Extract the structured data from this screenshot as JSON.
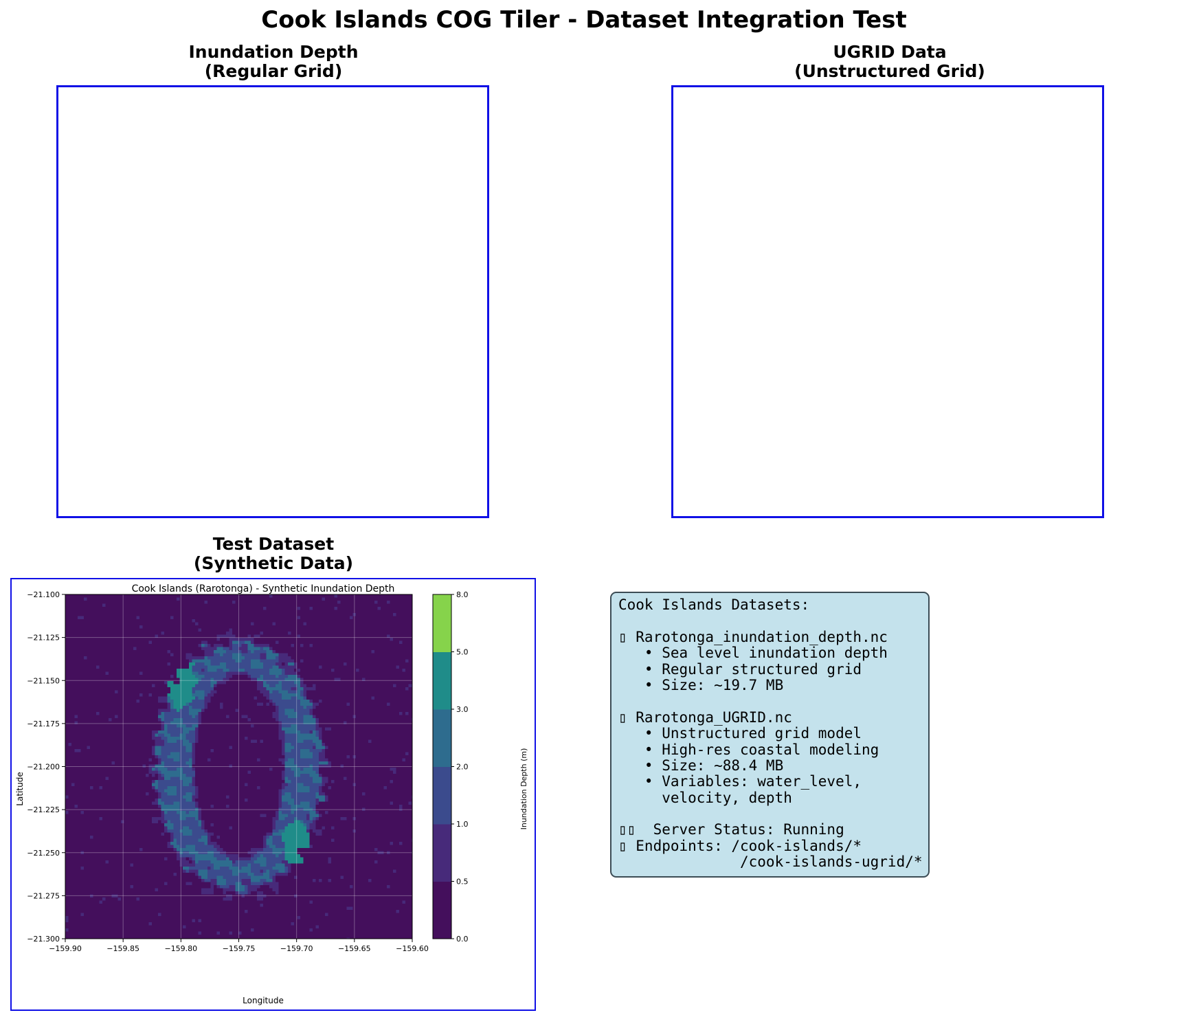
{
  "figure": {
    "title": "Cook Islands COG Tiler - Dataset Integration Test"
  },
  "panels": {
    "inundation": {
      "title_line1": "Inundation Depth",
      "title_line2": "(Regular Grid)"
    },
    "ugrid": {
      "title_line1": "UGRID Data",
      "title_line2": "(Unstructured Grid)"
    },
    "test": {
      "title_line1": "Test Dataset",
      "title_line2": "(Synthetic Data)"
    }
  },
  "colors": {
    "frame_border": "#1010e6",
    "info_box_bg": "#c4e2ec",
    "info_box_border": "#3c4c55"
  },
  "info_box": {
    "lines": [
      "Cook Islands Datasets:",
      "",
      "▯ Rarotonga_inundation_depth.nc",
      "   • Sea level inundation depth",
      "   • Regular structured grid",
      "   • Size: ~19.7 MB",
      "",
      "▯ Rarotonga_UGRID.nc",
      "   • Unstructured grid model",
      "   • High-res coastal modeling",
      "   • Size: ~88.4 MB",
      "   • Variables: water_level,",
      "     velocity, depth",
      "",
      "▯▯  Server Status: Running",
      "▯ Endpoints: /cook-islands/*",
      "              /cook-islands-ugrid/*"
    ]
  },
  "chart_data": {
    "type": "heatmap",
    "title": "Cook Islands (Rarotonga) - Synthetic Inundation Depth",
    "xlabel": "Longitude",
    "ylabel": "Latitude",
    "xlim": [
      -159.9,
      -159.6
    ],
    "ylim": [
      -21.3,
      -21.1
    ],
    "x_ticks": [
      -159.9,
      -159.85,
      -159.8,
      -159.75,
      -159.7,
      -159.65,
      -159.6
    ],
    "x_tick_labels": [
      "−159.90",
      "−159.85",
      "−159.80",
      "−159.75",
      "−159.70",
      "−159.65",
      "−159.60"
    ],
    "y_ticks": [
      -21.1,
      -21.125,
      -21.15,
      -21.175,
      -21.2,
      -21.225,
      -21.25,
      -21.275,
      -21.3
    ],
    "y_tick_labels": [
      "−21.100",
      "−21.125",
      "−21.150",
      "−21.175",
      "−21.200",
      "−21.225",
      "−21.250",
      "−21.275",
      "−21.300"
    ],
    "grid": true,
    "colorbar": {
      "label": "Inundation Depth (m)",
      "levels": [
        0.0,
        0.5,
        1.0,
        2.0,
        3.0,
        5.0,
        8.0
      ],
      "level_labels": [
        "0.0",
        "0.5",
        "1.0",
        "2.0",
        "3.0",
        "5.0",
        "8.0"
      ],
      "colors": [
        "#440f5c",
        "#472a7a",
        "#3b4b8d",
        "#2e6c8e",
        "#1f8c89",
        "#86d34b"
      ]
    },
    "features": {
      "ring_center": [
        -159.75,
        -21.2
      ],
      "ring_outer_radius_deg": [
        0.075,
        0.075
      ],
      "ring_inner_radius_deg": [
        0.038,
        0.052
      ],
      "ring_depth_range_m": [
        1.0,
        3.0
      ],
      "hotspots": [
        {
          "lon": -159.8,
          "lat": -21.152,
          "depth_range_m": [
            3.0,
            5.0
          ]
        },
        {
          "lon": -159.7,
          "lat": -21.245,
          "depth_range_m": [
            3.0,
            5.0
          ]
        }
      ],
      "background_depth_range_m": [
        0.0,
        0.5
      ]
    }
  }
}
